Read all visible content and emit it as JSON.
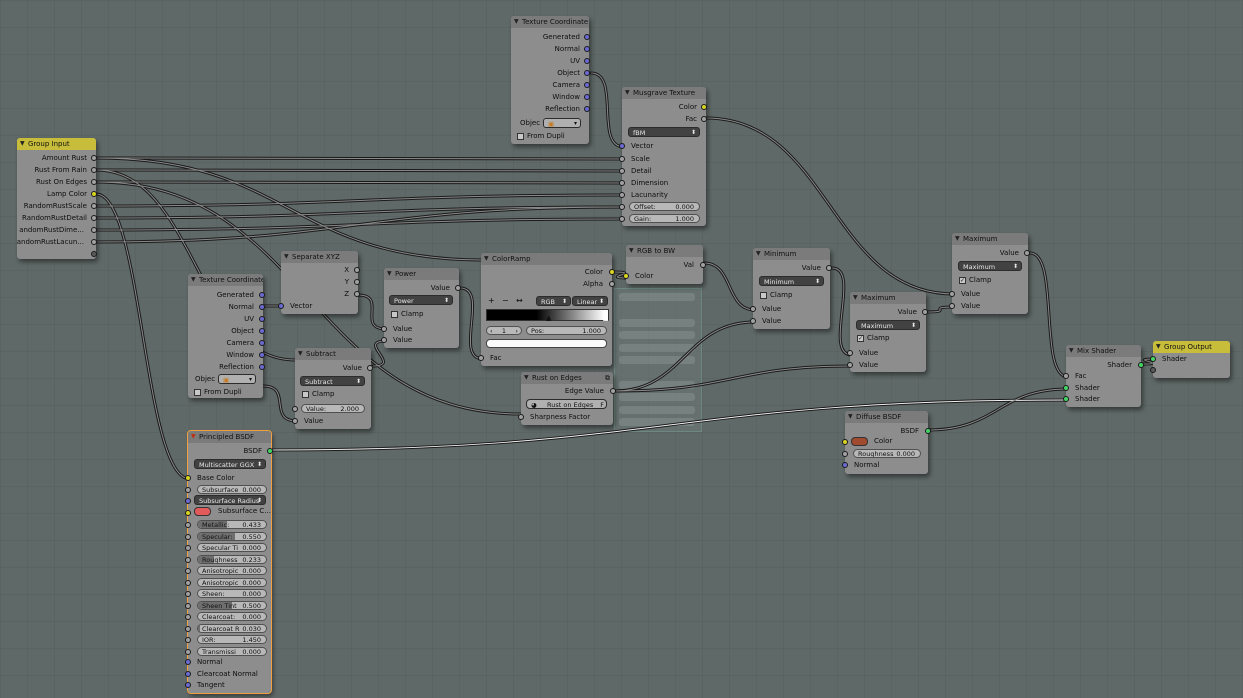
{
  "colors": {
    "canvas": "#5f6967",
    "node": "#8d8d8d",
    "group_header": "#c8bd3a",
    "wire": "#1c1c1c",
    "wire_highlight": "#f2f2f2",
    "socket_color": "#d7d322",
    "socket_vector": "#6a6ad2",
    "socket_value": "#a1a1a1",
    "socket_shader": "#43d565",
    "selected_outline": "#f0a040"
  },
  "group_input": {
    "title": "Group Input",
    "outputs": [
      "Amount Rust",
      "Rust From Rain",
      "Rust On Edges",
      "Lamp Color",
      "RandomRustScale",
      "RandomRustDetail",
      "andomRustDime...",
      "andomRustLacun..."
    ]
  },
  "tex_coord_top": {
    "title": "Texture Coordinate",
    "outputs": [
      "Generated",
      "Normal",
      "UV",
      "Object",
      "Camera",
      "Window",
      "Reflection"
    ],
    "object_label": "Objec",
    "from_dupli": "From Dupli"
  },
  "musgrave": {
    "title": "Musgrave Texture",
    "outputs": [
      "Color",
      "Fac"
    ],
    "type": "fBM",
    "inputs": [
      "Vector",
      "Scale",
      "Detail",
      "Dimension",
      "Lacunarity"
    ],
    "offset_label": "Offset:",
    "offset_value": "0.000",
    "gain_label": "Gain:",
    "gain_value": "1.000"
  },
  "tex_coord_left": {
    "title": "Texture Coordinate",
    "outputs": [
      "Generated",
      "Normal",
      "UV",
      "Object",
      "Camera",
      "Window",
      "Reflection"
    ],
    "object_label": "Objec",
    "from_dupli": "From Dupli"
  },
  "separate_xyz": {
    "title": "Separate XYZ",
    "outputs": [
      "X",
      "Y",
      "Z"
    ],
    "input": "Vector"
  },
  "power": {
    "title": "Power",
    "output": "Value",
    "op": "Power",
    "clamp": "Clamp",
    "inputs": [
      "Value",
      "Value"
    ]
  },
  "subtract": {
    "title": "Subtract",
    "output": "Value",
    "op": "Subtract",
    "clamp": "Clamp",
    "value_label": "Value:",
    "value_value": "2.000",
    "input": "Value"
  },
  "colorramp": {
    "title": "ColorRamp",
    "outputs": [
      "Color",
      "Alpha"
    ],
    "buttons": [
      "+",
      "−",
      "↔"
    ],
    "mode": "RGB",
    "interp": "Linear",
    "index": "1",
    "pos_label": "Pos:",
    "pos_value": "1.000",
    "input": "Fac"
  },
  "rgb_to_bw": {
    "title": "RGB to BW",
    "output": "Val",
    "input": "Color"
  },
  "rust_edges": {
    "title": "Rust on Edges",
    "output": "Edge Value",
    "group_name": "Rust on Edges",
    "input": "Sharpness Factor",
    "users": "F"
  },
  "minimum": {
    "title": "Minimum",
    "output": "Value",
    "op": "Minimum",
    "clamp": "Clamp",
    "inputs": [
      "Value",
      "Value"
    ]
  },
  "maximum_mid": {
    "title": "Maximum",
    "output": "Value",
    "op": "Maximum",
    "clamp": "Clamp",
    "clamp_checked": "✓",
    "inputs": [
      "Value",
      "Value"
    ]
  },
  "maximum_top": {
    "title": "Maximum",
    "output": "Value",
    "op": "Maximum",
    "clamp": "Clamp",
    "clamp_checked": "✓",
    "inputs": [
      "Value",
      "Value"
    ]
  },
  "diffuse": {
    "title": "Diffuse BSDF",
    "output": "BSDF",
    "color_label": "Color",
    "color": "#a04a30",
    "roughness_label": "Roughness",
    "roughness_value": "0.000",
    "normal": "Normal"
  },
  "mix_shader": {
    "title": "Mix Shader",
    "output": "Shader",
    "inputs": [
      "Fac",
      "Shader",
      "Shader"
    ]
  },
  "group_output": {
    "title": "Group Output",
    "input": "Shader"
  },
  "principled": {
    "title": "Principled BSDF",
    "output": "BSDF",
    "distribution": "Multiscatter GGX",
    "base_color": "Base Color",
    "subsurface_method": "Subsurface Radius",
    "subsurface_color_label": "Subsurface C...",
    "subsurface_color": "#e25a5a",
    "fields": [
      {
        "label": "Subsurface",
        "value": "0.000",
        "fill": 0.0
      },
      {
        "label": "Metallic:",
        "value": "0.433",
        "fill": 0.433
      },
      {
        "label": "Specular:",
        "value": "0.550",
        "fill": 0.55
      },
      {
        "label": "Specular Ti",
        "value": "0.000",
        "fill": 0.0
      },
      {
        "label": "Roughness",
        "value": "0.233",
        "fill": 0.233
      },
      {
        "label": "Anisotropic",
        "value": "0.000",
        "fill": 0.0
      },
      {
        "label": "Anisotropic",
        "value": "0.000",
        "fill": 0.0
      },
      {
        "label": "Sheen:",
        "value": "0.000",
        "fill": 0.0
      },
      {
        "label": "Sheen Tint",
        "value": "0.500",
        "fill": 0.5
      },
      {
        "label": "Clearcoat:",
        "value": "0.000",
        "fill": 0.0
      },
      {
        "label": "Clearcoat R",
        "value": "0.030",
        "fill": 0.03
      },
      {
        "label": "IOR:",
        "value": "1.450",
        "fill": 0.0
      },
      {
        "label": "Transmissi",
        "value": "0.000",
        "fill": 0.0
      }
    ],
    "vector_inputs": [
      "Normal",
      "Clearcoat Normal",
      "Tangent"
    ]
  }
}
